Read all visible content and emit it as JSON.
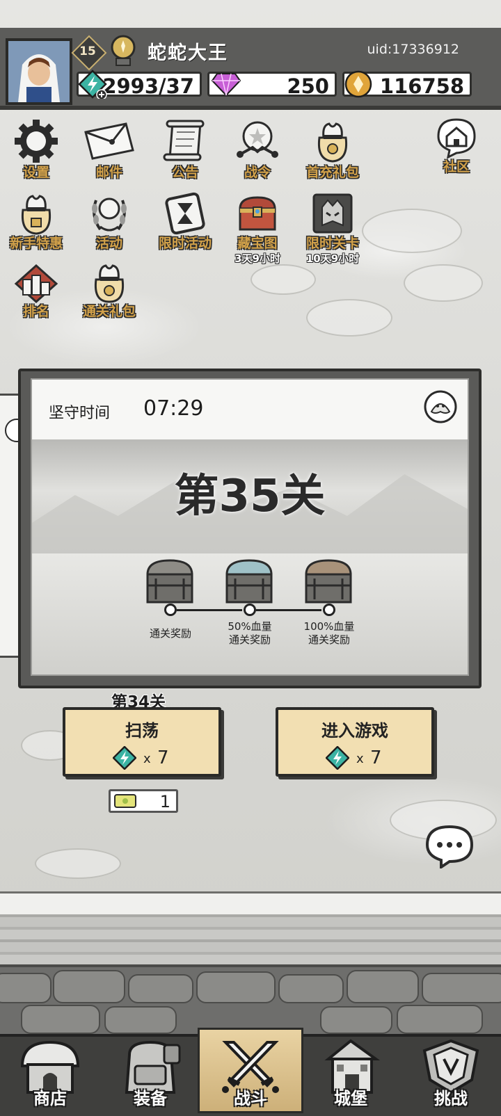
{
  "header": {
    "level": "15",
    "username": "蛇蛇大王",
    "uid": "uid:17336912",
    "stamina": "2993/37",
    "gems": "250",
    "coins": "116758"
  },
  "menu": {
    "row1": [
      "设置",
      "邮件",
      "公告",
      "战令",
      "首充礼包",
      "社区"
    ],
    "row2": [
      "新手特惠",
      "活动",
      "限时活动",
      "藏宝图",
      "限时关卡"
    ],
    "row2_timers": {
      "treasure_map": "3天9小时",
      "limited_stage": "10天9小时"
    },
    "row3": [
      "排名",
      "通关礼包"
    ]
  },
  "level_panel": {
    "hold_label": "坚守时间",
    "hold_time": "07:29",
    "title": "第35关",
    "rewards": [
      {
        "label": "通关奖励"
      },
      {
        "label": "50%血量\n通关奖励"
      },
      {
        "label": "100%血量\n通关奖励"
      }
    ]
  },
  "actions": {
    "prev_level": "第34关",
    "sweep_label": "扫荡",
    "sweep_cost_x": "x",
    "sweep_cost": "7",
    "enter_label": "进入游戏",
    "enter_cost_x": "x",
    "enter_cost": "7",
    "ticket_count": "1"
  },
  "nav": {
    "items": [
      "商店",
      "装备",
      "战斗",
      "城堡",
      "挑战"
    ],
    "active": "战斗"
  },
  "colors": {
    "accent": "#f2dfb2",
    "menu_text": "#d3a24a",
    "stamina_icon": "#3bb3a3",
    "gem": "#c85fd6",
    "coin": "#e0a43a"
  },
  "icons": {
    "stamina": "lightning-gem-icon",
    "gem": "diamond-icon",
    "coin": "coin-icon",
    "chat": "chat-bubble-icon"
  }
}
